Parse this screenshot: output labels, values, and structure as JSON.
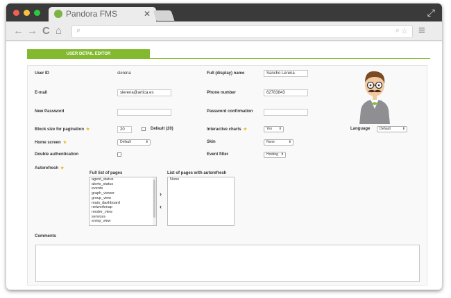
{
  "browser": {
    "tab_title": "Pandora FMS",
    "tab_close": "✕",
    "fullscreen_glyph": "⤢",
    "back_glyph": "←",
    "forward_glyph": "→",
    "reload_glyph": "C",
    "home_glyph": "⌂",
    "search_glyph": "⌕",
    "zoom_glyph": "⌕",
    "star_glyph": "☆",
    "menu_glyph": "≡"
  },
  "section": {
    "tab_label": "USER DETAIL EDITOR"
  },
  "form": {
    "user_id": {
      "label": "User ID",
      "value": "slerena"
    },
    "full_name": {
      "label": "Full (display) name",
      "value": "Sancho Lerena"
    },
    "email": {
      "label": "E-mail",
      "value": "slerena@artica.es"
    },
    "phone": {
      "label": "Phone number",
      "value": "62783843"
    },
    "new_password": {
      "label": "New Password",
      "value": ""
    },
    "password_confirm": {
      "label": "Password confirmation",
      "value": ""
    },
    "block_size": {
      "label": "Block size for pagination",
      "value": "20",
      "default_label": "Default (20)"
    },
    "interactive_charts": {
      "label": "Interactive charts",
      "value": "Yes"
    },
    "language": {
      "label": "Language",
      "value": "Default"
    },
    "home_screen": {
      "label": "Home screen",
      "value": "Default"
    },
    "skin": {
      "label": "Skin",
      "value": "None"
    },
    "double_auth": {
      "label": "Double authentication"
    },
    "event_filter": {
      "label": "Event filter",
      "value": "Hosting"
    },
    "autorefresh": {
      "label": "Autorefresh"
    },
    "full_list": {
      "label": "Full list of pages",
      "items": [
        "agent_status",
        "alerts_status",
        "events",
        "graph_viewer",
        "group_view",
        "main_dashboard",
        "networkmap",
        "render_view",
        "services",
        "snmp_view"
      ]
    },
    "autorefresh_list": {
      "label": "List of pages with autorefresh",
      "items": [
        "None"
      ]
    },
    "move_right": "›",
    "move_left": "‹",
    "comments": {
      "label": "Comments",
      "value": ""
    }
  },
  "colors": {
    "accent": "#82b92e",
    "titlebar": "#3a3a3a"
  }
}
